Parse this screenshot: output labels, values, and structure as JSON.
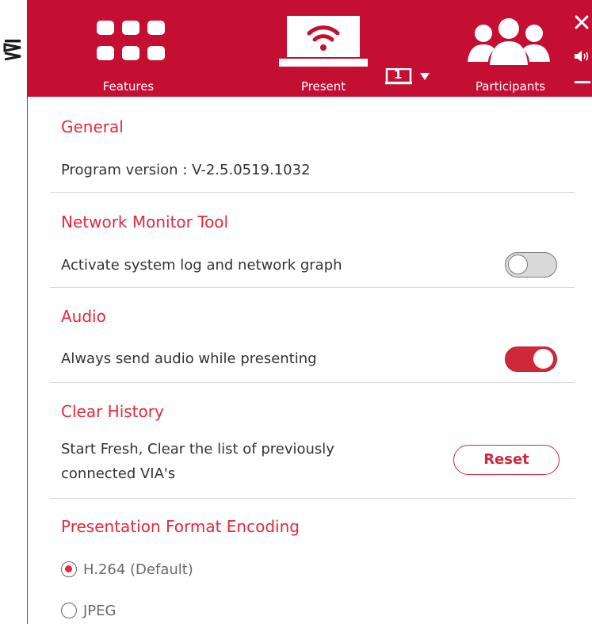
{
  "brand": {
    "logo_text": "VIA"
  },
  "header": {
    "nav": {
      "features_label": "Features",
      "present_label": "Present",
      "participants_label": "Participants"
    },
    "screen_selector_value": "1"
  },
  "sections": {
    "general": {
      "title": "General",
      "program_version": "Program version :  V-2.5.0519.1032"
    },
    "network_monitor": {
      "title": "Network Monitor Tool",
      "label": "Activate system log and network graph",
      "enabled": false
    },
    "audio": {
      "title": "Audio",
      "label": "Always send audio while presenting",
      "enabled": true
    },
    "clear_history": {
      "title": "Clear History",
      "label_line1": "Start Fresh, Clear the list of previously",
      "label_line2": "connected VIA's",
      "button_label": "Reset"
    },
    "presentation_format": {
      "title": "Presentation Format Encoding",
      "options": [
        {
          "label": "H.264 (Default)",
          "selected": true
        },
        {
          "label": "JPEG",
          "selected": false
        }
      ]
    }
  },
  "colors": {
    "header_bg": "#c40f33",
    "accent": "#e6283c",
    "toggle_on": "#d0283a"
  },
  "icons": {
    "features": "grid-icon",
    "present": "wifi-laptop-icon",
    "participants": "people-icon",
    "close": "close-icon",
    "volume": "volume-icon",
    "minimize": "minimize-icon",
    "dropdown": "triangle-down-icon",
    "monitor": "monitor-number-icon"
  }
}
